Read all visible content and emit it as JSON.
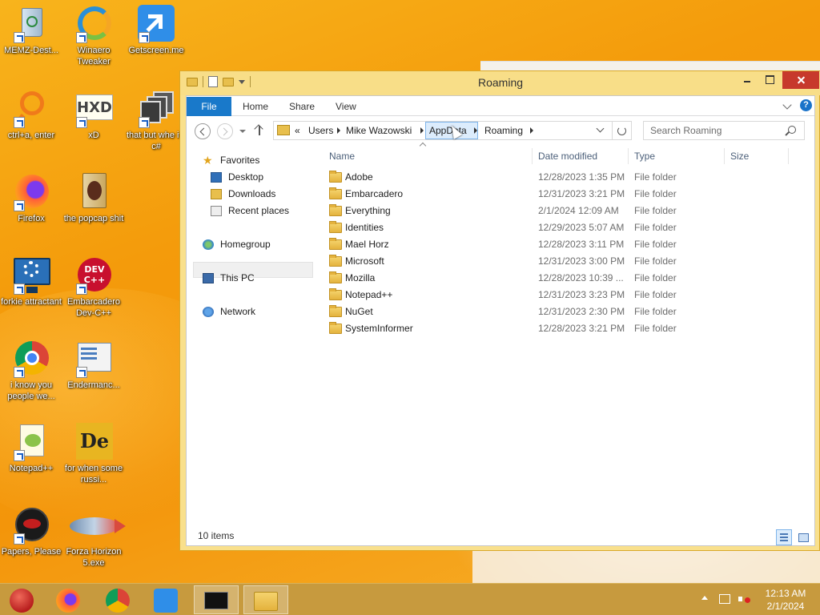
{
  "desktop": {
    "icons": [
      {
        "label": "MEMZ-Dest...",
        "icon": "recycle-bin-icon"
      },
      {
        "label": "Winaero Tweaker",
        "icon": "winaero-tweaker-icon"
      },
      {
        "label": "Getscreen.me",
        "icon": "getscreen-icon"
      },
      {
        "label": "ctrl+a, enter",
        "icon": "magnifier-icon"
      },
      {
        "label": "xD",
        "icon": "hxd-icon"
      },
      {
        "label": "that but whe its c#",
        "icon": "stacked-windows-icon"
      },
      {
        "label": "Firefox",
        "icon": "firefox-icon"
      },
      {
        "label": "the popcap shit",
        "icon": "popcap-icon"
      },
      {
        "label": "forkie attractant",
        "icon": "monitor-gear-icon"
      },
      {
        "label": "Embarcadero Dev-C++",
        "icon": "devcpp-icon"
      },
      {
        "label": "i know you people we...",
        "icon": "chrome-icon"
      },
      {
        "label": "Endermanc...",
        "icon": "document-window-icon"
      },
      {
        "label": "Notepad++",
        "icon": "notepad-plus-plus-icon"
      },
      {
        "label": "for when some russi...",
        "icon": "de-icon"
      },
      {
        "label": "Papers, Please",
        "icon": "papers-please-icon"
      },
      {
        "label": "Forza Horizon 5.exe",
        "icon": "fish-icon"
      }
    ]
  },
  "window": {
    "title": "Roaming",
    "ribbon": {
      "tabs": [
        "File",
        "Home",
        "Share",
        "View"
      ]
    },
    "address": {
      "overflow": "«",
      "crumbs": [
        "Users",
        "Mike Wazowski",
        "AppData",
        "Roaming"
      ]
    },
    "search": {
      "placeholder": "Search Roaming"
    },
    "nav_pane": {
      "favorites": "Favorites",
      "desktop": "Desktop",
      "downloads": "Downloads",
      "recent": "Recent places",
      "homegroup": "Homegroup",
      "this_pc": "This PC",
      "network": "Network"
    },
    "columns": {
      "name": "Name",
      "date": "Date modified",
      "type": "Type",
      "size": "Size"
    },
    "files": [
      {
        "name": "Adobe",
        "date": "12/28/2023 1:35 PM",
        "type": "File folder"
      },
      {
        "name": "Embarcadero",
        "date": "12/31/2023 3:21 PM",
        "type": "File folder"
      },
      {
        "name": "Everything",
        "date": "2/1/2024 12:09 AM",
        "type": "File folder"
      },
      {
        "name": "Identities",
        "date": "12/29/2023 5:07 AM",
        "type": "File folder"
      },
      {
        "name": "Mael Horz",
        "date": "12/28/2023 3:11 PM",
        "type": "File folder"
      },
      {
        "name": "Microsoft",
        "date": "12/31/2023 3:00 PM",
        "type": "File folder"
      },
      {
        "name": "Mozilla",
        "date": "12/28/2023 10:39 ...",
        "type": "File folder"
      },
      {
        "name": "Notepad++",
        "date": "12/31/2023 3:23 PM",
        "type": "File folder"
      },
      {
        "name": "NuGet",
        "date": "12/31/2023 2:30 PM",
        "type": "File folder"
      },
      {
        "name": "SystemInformer",
        "date": "12/28/2023 3:21 PM",
        "type": "File folder"
      }
    ],
    "status": "10 items"
  },
  "taskbar": {
    "apps": [
      "memz-ornament-icon",
      "firefox-icon",
      "chrome-icon",
      "getscreen-icon",
      "command-prompt-icon",
      "file-explorer-icon"
    ],
    "clock_time": "12:13 AM",
    "clock_date": "2/1/2024"
  },
  "colors": {
    "accent": "#1979ca",
    "desktop": "#f49b0b",
    "window_frame": "#f9e08c",
    "close": "#c7392c"
  }
}
